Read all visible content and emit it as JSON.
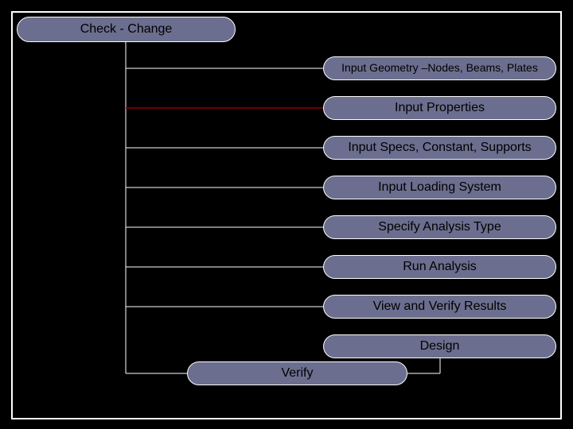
{
  "nodes": {
    "check_change": "Check - Change",
    "geometry": "Input Geometry –Nodes, Beams, Plates",
    "properties": "Input Properties",
    "specs": "Input Specs, Constant, Supports",
    "loading": "Input Loading System",
    "analysis": "Specify Analysis Type",
    "run": "Run Analysis",
    "results": "View and Verify Results",
    "design": "Design",
    "verify": "Verify"
  }
}
